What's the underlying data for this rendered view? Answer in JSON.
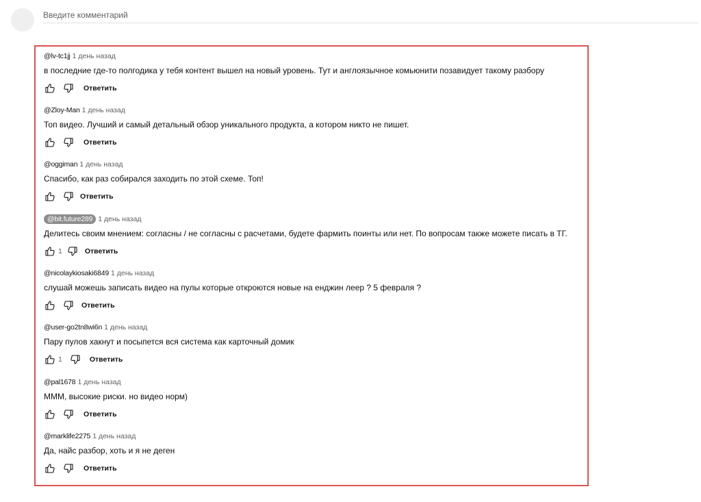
{
  "add_comment": {
    "placeholder": "Введите комментарий"
  },
  "reply_label": "Ответить",
  "comments": [
    {
      "author": "@lv-tc1jj",
      "time": "1 день назад",
      "text": "в последние где-то полгодика у тебя контент вышел на новый уровень. Тут и англоязычное комьюнити позавидует такому разбору",
      "likes": ""
    },
    {
      "author": "@Zloy-Man",
      "time": "1 день назад",
      "text": "Топ видео. Лучший и самый детальный обзор уникального продукта, а котором никто не пишет.",
      "likes": ""
    },
    {
      "author": "@oggiman",
      "time": "1 день назад",
      "text": "Спасибо, как раз собирался заходить по этой схеме. Топ!",
      "likes": ""
    },
    {
      "author": "@bit.future289",
      "time": "1 день назад",
      "text": "Делитесь своим мнением: согласны / не согласны с расчетами, будете фармить поинты или нет. По вопросам также можете писать в ТГ.",
      "likes": "1",
      "highlighted": true
    },
    {
      "author": "@nicolaykiosaki6849",
      "time": "1 день назад",
      "text": "слушай можешь записать видео на пулы которые откроются новые на енджин леер ? 5 февраля ?",
      "likes": ""
    },
    {
      "author": "@user-go2tn8wi6n",
      "time": "1 день назад",
      "text": "Пару пулов хакнут и посыпется вся система как карточный домик",
      "likes": "1"
    },
    {
      "author": "@pal1678",
      "time": "1 день назад",
      "text": "МММ,  высокие риски. но видео норм)",
      "likes": ""
    },
    {
      "author": "@marklife2275",
      "time": "1 день назад",
      "text": "Да, найс разбор, хоть и я не деген",
      "likes": ""
    }
  ]
}
